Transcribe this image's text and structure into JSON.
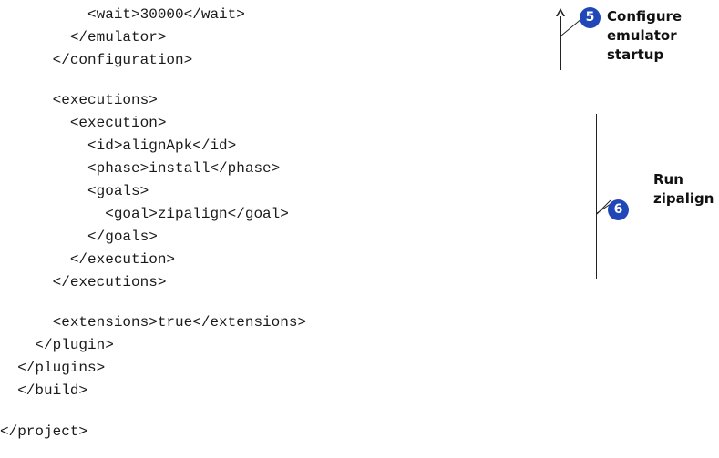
{
  "code_lines": [
    "          <wait>30000</wait>",
    "        </emulator>",
    "      </configuration>",
    "",
    "      <executions>",
    "        <execution>",
    "          <id>alignApk</id>",
    "          <phase>install</phase>",
    "          <goals>",
    "            <goal>zipalign</goal>",
    "          </goals>",
    "        </execution>",
    "      </executions>",
    "",
    "      <extensions>true</extensions>",
    "    </plugin>",
    "  </plugins>",
    "  </build>",
    "",
    "</project>"
  ],
  "annotations": [
    {
      "number": "5",
      "text": "Configure\nemulator\nstartup",
      "icon": "numbered-circle-icon",
      "color": "#1f47b8"
    },
    {
      "number": "6",
      "text": "Run\nzipalign",
      "icon": "numbered-circle-icon",
      "color": "#1f47b8"
    }
  ]
}
